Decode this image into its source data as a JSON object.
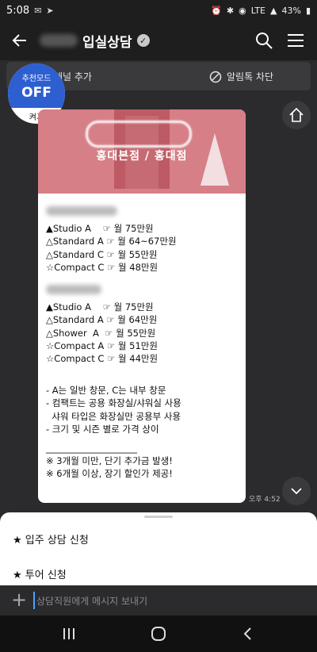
{
  "status": {
    "time": "5:08",
    "battery": "43%",
    "network": "LTE"
  },
  "appbar": {
    "title": "입실상담"
  },
  "quickbar": {
    "add_channel": "채널 추가",
    "block_talk": "알림톡 차단"
  },
  "badge": {
    "line1": "추천모드",
    "line2": "OFF",
    "action": "켜기"
  },
  "card": {
    "branch": "홍대본점 / 홍대점",
    "section1": [
      "▲Studio A    ☞ 월 75만원",
      "△Standard A ☞ 월 64~67만원",
      "△Standard C ☞ 월 55만원",
      "☆Compact C ☞ 월 48만원"
    ],
    "section2": [
      "▲Studio A    ☞ 월 75만원",
      "△Standard A ☞ 월 64만원",
      "△Shower  A  ☞ 월 55만원",
      "☆Compact A ☞ 월 51만원",
      "☆Compact C ☞ 월 44만원"
    ],
    "notes": [
      "- A는 일반 창문, C는 내부 창문",
      "- 컴팩트는 공용 화장실/샤워실 사용",
      "  샤워 타입은 화장실만 공용부 사용",
      "- 크기 및 시즌 별로 가격 상이"
    ],
    "divider": "____________________",
    "footer": [
      "※ 3개월 미만, 단기 추가금 발생!",
      "※ 6개월 이상, 장기 할인가 제공!"
    ]
  },
  "timestamp": "오후 4:52",
  "sheet": {
    "item1": "★ 입주 상담 신청",
    "item2": "★ 투어 신청"
  },
  "input": {
    "placeholder": "상담직원에게 메시지 보내기"
  }
}
